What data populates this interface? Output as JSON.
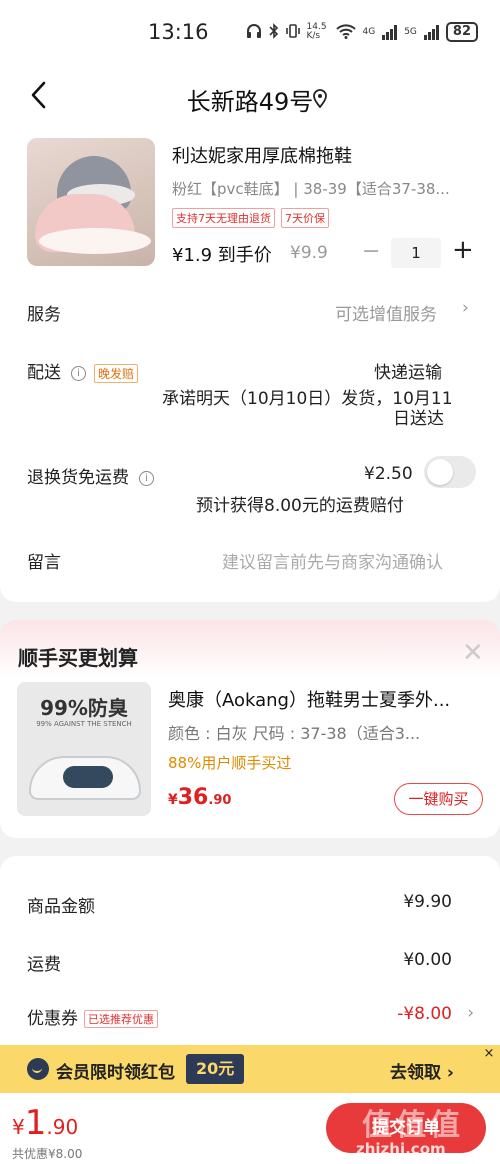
{
  "status_bar": {
    "time": "13:16",
    "net_speed": "14.5 K/s",
    "net_type_1": "4G",
    "net_type_2": "5G",
    "battery": "82"
  },
  "nav": {
    "title": "长新路49号"
  },
  "product": {
    "title": "利达妮家用厚底棉拖鞋",
    "spec": "粉红【pvc鞋底】 | 38-39【适合37-38...",
    "tags": [
      "支持7天无理由退货",
      "7天价保"
    ],
    "price": "¥1.9 到手价",
    "original_price": "¥9.9",
    "qty_minus": "−",
    "quantity": "1",
    "qty_plus": "+"
  },
  "rows": {
    "service_label": "服务",
    "service_value": "可选增值服务",
    "service_chevron": "›",
    "delivery_label": "配送",
    "delivery_badge": "晚发赔",
    "delivery_method": "快递运输",
    "delivery_line1": "承诺明天（10月10日）发货，10月11",
    "delivery_line2": "日送达",
    "return_label": "退换货免运费",
    "return_price": "¥2.50",
    "return_note": "预计获得8.00元的运费赔付",
    "message_label": "留言",
    "message_placeholder": "建议留言前先与商家沟通确认",
    "info_glyph": "i"
  },
  "upsell": {
    "title": "顺手买更划算",
    "close": "✕",
    "image_headline": "99%防臭",
    "image_sub": "99% AGAINST THE STENCH",
    "name": "奥康（Aokang）拖鞋男士夏季外...",
    "spec": "颜色 : 白灰   尺码 : 37-38（适合3...",
    "social": "88%用户顺手买过",
    "price_currency": "¥",
    "price_int": "36",
    "price_dec": ".90",
    "buy_label": "一键购买"
  },
  "summary": {
    "goods_label": "商品金额",
    "goods_value": "¥9.90",
    "shipping_label": "运费",
    "shipping_value": "¥0.00",
    "coupon_label": "优惠券",
    "coupon_tag": "已选推荐优惠",
    "coupon_value": "-¥8.00",
    "coupon_chevron": "›"
  },
  "banner": {
    "text": "会员限时领红包",
    "amount": "20元",
    "cta": "去领取 ›",
    "close": "×"
  },
  "footer": {
    "total_currency": "¥",
    "total_int": "1",
    "total_dec": ".90",
    "discount_note": "共优惠¥8.00",
    "submit_label": "提交订单"
  },
  "watermark": {
    "chars": "值值值",
    "url": "zhizhi.com"
  },
  "colors": {
    "accent_red": "#e02020",
    "banner_yellow": "#fbd86a",
    "banner_navy": "#2d3a56",
    "social_orange": "#e08a00"
  }
}
